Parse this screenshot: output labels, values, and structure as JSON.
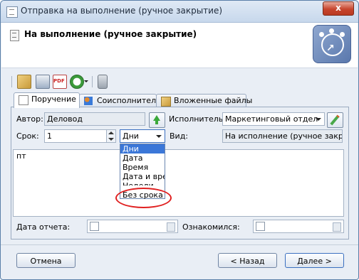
{
  "window": {
    "title": "Отправка на выполнение (ручное закрытие)",
    "close_label": "x"
  },
  "header": {
    "title": "На выполнение (ручное закрытие)"
  },
  "toolbar": {
    "icons": [
      "paperclip-pencil-icon",
      "scanner-icon",
      "pdf-icon",
      "alarm-clock-icon",
      "dropdown-arrow-icon",
      "padlock-icon"
    ],
    "pdf_label": "PDF"
  },
  "tabs": [
    {
      "label": "Поручение",
      "icon": "document-icon"
    },
    {
      "label": "Соисполнители",
      "icon": "people-icon"
    },
    {
      "label": "Вложенные файлы",
      "icon": "attachment-icon"
    }
  ],
  "form": {
    "author_label": "Автор:",
    "author_value": "Деловод",
    "executor_label": "Исполнитель:",
    "executor_value": "Маркетинговый отдел",
    "term_label": "Срок:",
    "term_value": "1",
    "unit_value": "Дни",
    "kind_label": "Вид:",
    "kind_value": "На исполнение (ручное закрыти",
    "memo_text": "пт",
    "report_date_label": "Дата отчета:",
    "acquainted_label": "Ознакомился:"
  },
  "dropdown": {
    "options": [
      "Дни",
      "Дата",
      "Время",
      "Дата и врем",
      "Недели"
    ],
    "selected_index": 0,
    "highlighted_option": "Без срока"
  },
  "buttons": {
    "cancel": "Отмена",
    "back": "< Назад",
    "next": "Далее >"
  },
  "colors": {
    "selection": "#3b77d8",
    "annotation": "#e02020",
    "close": "#c7452d"
  }
}
